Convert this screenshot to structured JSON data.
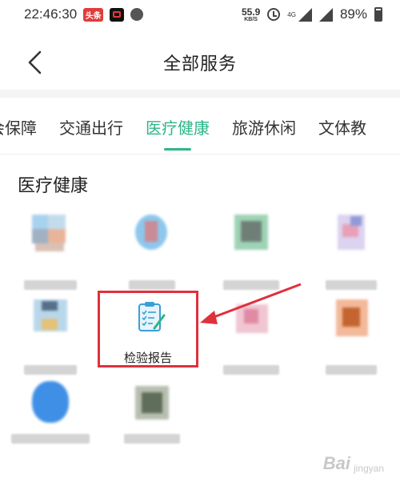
{
  "status_bar": {
    "time": "22:46:30",
    "app_badge_text": "头条",
    "net_speed_value": "55.9",
    "net_speed_unit": "KB/S",
    "network_type": "4G",
    "battery_percent": "89%"
  },
  "header": {
    "title": "全部服务",
    "back_icon": "chevron-left-icon"
  },
  "tabs": [
    {
      "label": "会保障",
      "active": false
    },
    {
      "label": "交通出行",
      "active": false
    },
    {
      "label": "医疗健康",
      "active": true
    },
    {
      "label": "旅游休闲",
      "active": false
    },
    {
      "label": "文体教",
      "active": false
    }
  ],
  "section": {
    "title": "医疗健康"
  },
  "featured_service": {
    "label": "检验报告",
    "icon": "clipboard-checklist-icon"
  },
  "colors": {
    "accent": "#2bb58a",
    "highlight_box": "#e0303c",
    "arrow": "#e0303c"
  },
  "watermark": {
    "brand": "Bai",
    "sub": "jingyan"
  }
}
